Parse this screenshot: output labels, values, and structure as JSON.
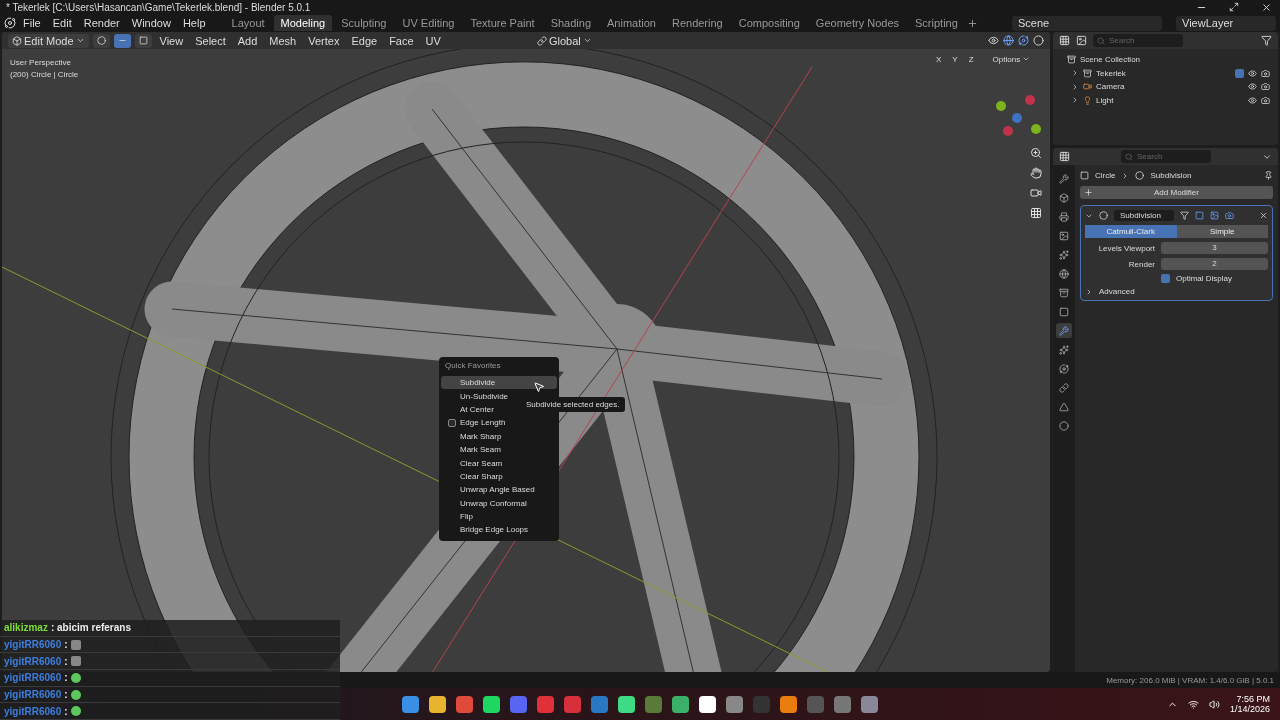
{
  "window": {
    "title": "* Tekerlek [C:\\Users\\Hasancan\\Game\\Tekerlek.blend] - Blender 5.0.1"
  },
  "menu": {
    "items": [
      "File",
      "Edit",
      "Render",
      "Window",
      "Help"
    ]
  },
  "workspaces": [
    {
      "label": "Layout",
      "selected": false
    },
    {
      "label": "Modeling",
      "selected": true
    },
    {
      "label": "Sculpting",
      "selected": false
    },
    {
      "label": "UV Editing",
      "selected": false
    },
    {
      "label": "Texture Paint",
      "selected": false
    },
    {
      "label": "Shading",
      "selected": false
    },
    {
      "label": "Animation",
      "selected": false
    },
    {
      "label": "Rendering",
      "selected": false
    },
    {
      "label": "Compositing",
      "selected": false
    },
    {
      "label": "Geometry Nodes",
      "selected": false
    },
    {
      "label": "Scripting",
      "selected": false
    }
  ],
  "scene_field": {
    "value": "Scene"
  },
  "view_layer_field": {
    "value": "ViewLayer"
  },
  "viewport": {
    "mode": "Edit Mode",
    "select_modes": [
      {
        "kind": "vertex",
        "selected": false
      },
      {
        "kind": "edge",
        "selected": true
      },
      {
        "kind": "face",
        "selected": false
      }
    ],
    "header_menus": [
      "View",
      "Select",
      "Add",
      "Mesh",
      "Vertex",
      "Edge",
      "Face",
      "UV"
    ],
    "orientation": "Global",
    "axis_buttons": [
      "X",
      "Y",
      "Z"
    ],
    "options": "Options",
    "overlay_lines": [
      "User Perspective",
      "(200) Circle | Circle"
    ]
  },
  "quick_favorites": {
    "title": "Quick Favorites",
    "items": [
      {
        "label": "Subdivide",
        "kind": "item",
        "selected": true
      },
      {
        "label": "Un-Subdivide",
        "kind": "item",
        "selected": false
      },
      {
        "label": "At Center",
        "kind": "item",
        "selected": false
      },
      {
        "label": "Edge Length",
        "kind": "checkbox",
        "checked": false,
        "selected": false
      },
      {
        "label": "Mark Sharp",
        "kind": "item",
        "selected": false
      },
      {
        "label": "Mark Seam",
        "kind": "item",
        "selected": false
      },
      {
        "label": "Clear Seam",
        "kind": "item",
        "selected": false
      },
      {
        "label": "Clear Sharp",
        "kind": "item",
        "selected": false
      },
      {
        "label": "Unwrap Angle Based",
        "kind": "item",
        "selected": false
      },
      {
        "label": "Unwrap Conformal",
        "kind": "item",
        "selected": false
      },
      {
        "label": "Flip",
        "kind": "item",
        "selected": false
      },
      {
        "label": "Bridge Edge Loops",
        "kind": "item",
        "selected": false
      }
    ]
  },
  "tooltip": "Subdivide selected edges.",
  "outliner": {
    "search_placeholder": "Search",
    "root": "Scene Collection",
    "items": [
      {
        "name": "Tekerlek",
        "kind": "collection",
        "checked": true
      },
      {
        "name": "Camera",
        "kind": "camera"
      },
      {
        "name": "Light",
        "kind": "light"
      }
    ]
  },
  "properties": {
    "search_placeholder": "Search",
    "tabs": [
      {
        "kind": "tool",
        "selected": false
      },
      {
        "kind": "render",
        "selected": false
      },
      {
        "kind": "output",
        "selected": false
      },
      {
        "kind": "view",
        "selected": false
      },
      {
        "kind": "scene",
        "selected": false
      },
      {
        "kind": "world",
        "selected": false
      },
      {
        "kind": "collection",
        "selected": false
      },
      {
        "kind": "object",
        "selected": false
      },
      {
        "kind": "modifier",
        "selected": true
      },
      {
        "kind": "particles",
        "selected": false
      },
      {
        "kind": "physics",
        "selected": false
      },
      {
        "kind": "constraints",
        "selected": false
      },
      {
        "kind": "data",
        "selected": false
      },
      {
        "kind": "material",
        "selected": false
      }
    ],
    "breadcrumb": [
      "Circle",
      "Subdivision"
    ],
    "add_modifier": "Add Modifier",
    "modifier": {
      "name": "Subdivision",
      "methods": [
        {
          "label": "Catmull-Clark",
          "selected": true
        },
        {
          "label": "Simple",
          "selected": false
        }
      ],
      "fields": [
        {
          "label": "Levels Viewport",
          "value": "3"
        },
        {
          "label": "Render",
          "value": "2"
        }
      ],
      "optimal_display": {
        "label": "Optimal Display",
        "checked": true
      },
      "advanced": {
        "label": "Advanced",
        "expanded": false
      }
    }
  },
  "chat": [
    {
      "user": "alikizmaz",
      "color": "#7ddc3a",
      "kind": "text",
      "message": ": abicim referans"
    },
    {
      "user": "yigitRR6060",
      "color": "#3d7fe0",
      "kind": "emote",
      "message": ":"
    },
    {
      "user": "yigitRR6060",
      "color": "#3d7fe0",
      "kind": "emote",
      "message": ":"
    },
    {
      "user": "yigitRR6060",
      "color": "#3d7fe0",
      "kind": "emote",
      "message": ":"
    },
    {
      "user": "yigitRR6060",
      "color": "#3d7fe0",
      "kind": "emote",
      "message": ":"
    },
    {
      "user": "yigitRR6060",
      "color": "#3d7fe0",
      "kind": "emote",
      "message": ":"
    }
  ],
  "status_bar": "Memory: 206.0 MiB | VRAM: 1.4/6.0 GiB | 5.0.1",
  "taskbar": {
    "time": "7:56 PM",
    "date": "1/14/2026"
  }
}
